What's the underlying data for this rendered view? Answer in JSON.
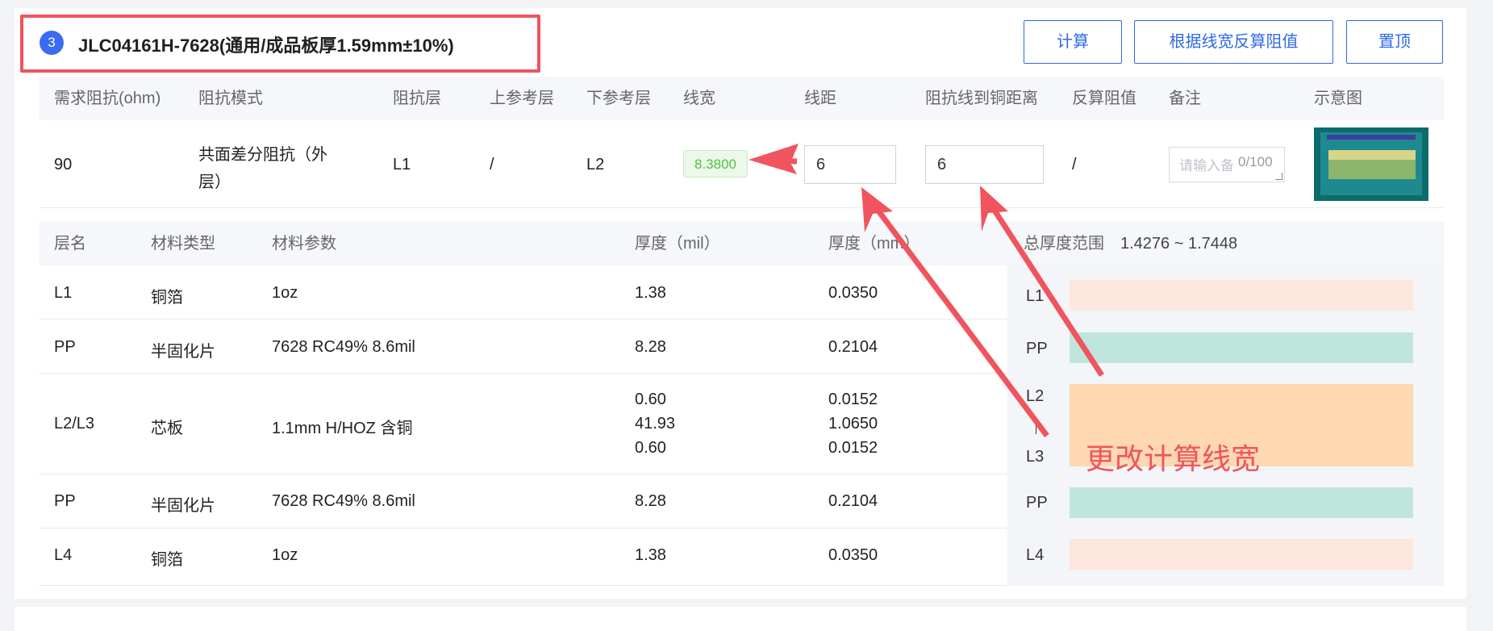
{
  "header": {
    "index": "3",
    "title": "JLC04161H-7628(通用/成品板厚1.59mm±10%)",
    "buttons": [
      "计算",
      "根据线宽反算阻值",
      "置顶"
    ]
  },
  "impedance_table": {
    "columns": [
      "需求阻抗(ohm)",
      "阻抗模式",
      "阻抗层",
      "上参考层",
      "下参考层",
      "线宽",
      "线距",
      "阻抗线到铜距离",
      "反算阻值",
      "备注",
      "示意图"
    ],
    "row": {
      "impedance": "90",
      "mode_line1": "共面差分阻抗（外",
      "mode_line2": "层）",
      "layer": "L1",
      "upper_ref": "/",
      "lower_ref": "L2",
      "line_width": "8.3800",
      "spacing": "6",
      "copper_distance": "6",
      "calc_value": "/",
      "remark_placeholder": "请输入备",
      "remark_count": "0/100"
    }
  },
  "stackup": {
    "columns": [
      "层名",
      "材料类型",
      "材料参数",
      "厚度（mil）",
      "厚度（mm）"
    ],
    "total_label": "总厚度范围",
    "total_range": "1.4276 ~ 1.7448",
    "rows": [
      {
        "name": "L1",
        "type": "铜箔",
        "param": "1oz",
        "mil": "1.38",
        "mm": "0.0350"
      },
      {
        "name": "PP",
        "type": "半固化片",
        "param": "7628 RC49% 8.6mil",
        "mil": "8.28",
        "mm": "0.2104"
      },
      {
        "name": "L2/L3",
        "type": "芯板",
        "param": "1.1mm H/HOZ 含铜",
        "mil1": "0.60",
        "mil2": "41.93",
        "mil3": "0.60",
        "mm1": "0.0152",
        "mm2": "1.0650",
        "mm3": "0.0152"
      },
      {
        "name": "PP",
        "type": "半固化片",
        "param": "7628 RC49% 8.6mil",
        "mil": "8.28",
        "mm": "0.2104"
      },
      {
        "name": "L4",
        "type": "铜箔",
        "param": "1oz",
        "mil": "1.38",
        "mm": "0.0350"
      }
    ],
    "side_labels": [
      "L1",
      "PP",
      "L2",
      "L3",
      "PP",
      "L4"
    ],
    "colors": {
      "copper": "#fde6dc",
      "pp": "#c0e5dc",
      "core": "#fdd8b0"
    }
  },
  "annotation": "更改计算线宽",
  "colors": {
    "accent": "#2f6ae6",
    "highlight": "#f0545e"
  }
}
